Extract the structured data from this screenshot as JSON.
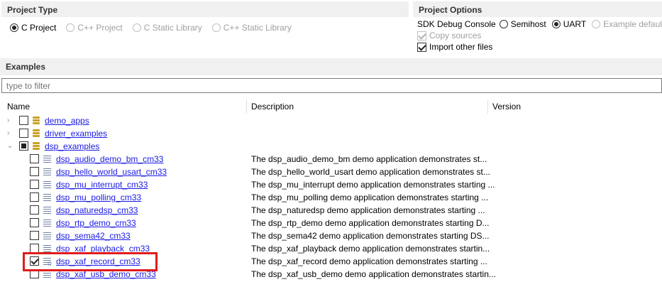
{
  "project_type": {
    "header": "Project Type",
    "options": [
      {
        "label": "C Project",
        "selected": true,
        "disabled": false
      },
      {
        "label": "C++ Project",
        "selected": false,
        "disabled": true
      },
      {
        "label": "C Static Library",
        "selected": false,
        "disabled": true
      },
      {
        "label": "C++ Static Library",
        "selected": false,
        "disabled": true
      }
    ]
  },
  "project_options": {
    "header": "Project Options",
    "console_label": "SDK Debug Console",
    "console_options": [
      {
        "label": "Semihost",
        "selected": false,
        "disabled": false
      },
      {
        "label": "UART",
        "selected": true,
        "disabled": false
      },
      {
        "label": "Example default",
        "selected": false,
        "disabled": true
      }
    ],
    "copy_sources": {
      "label": "Copy sources",
      "checked": true,
      "disabled": true
    },
    "import_other_files": {
      "label": "Import other files",
      "checked": true,
      "disabled": false
    }
  },
  "examples": {
    "header": "Examples",
    "filter_placeholder": "type to filter",
    "columns": {
      "name": "Name",
      "description": "Description",
      "version": "Version"
    },
    "groups": [
      {
        "name": "demo_apps",
        "expanded": false,
        "check": "none"
      },
      {
        "name": "driver_examples",
        "expanded": false,
        "check": "none"
      },
      {
        "name": "dsp_examples",
        "expanded": true,
        "check": "partial"
      }
    ],
    "items": [
      {
        "name": "dsp_audio_demo_bm_cm33",
        "description": "The dsp_audio_demo_bm demo application demonstrates st...",
        "checked": false
      },
      {
        "name": "dsp_hello_world_usart_cm33",
        "description": "The dsp_hello_world_usart demo application demonstrates st...",
        "checked": false
      },
      {
        "name": "dsp_mu_interrupt_cm33",
        "description": "The dsp_mu_interrupt demo application demonstrates starting ...",
        "checked": false
      },
      {
        "name": "dsp_mu_polling_cm33",
        "description": "The dsp_mu_polling demo application demonstrates starting ...",
        "checked": false
      },
      {
        "name": "dsp_naturedsp_cm33",
        "description": "The dsp_naturedsp demo application demonstrates starting ...",
        "checked": false
      },
      {
        "name": "dsp_rtp_demo_cm33",
        "description": "The dsp_rtp_demo demo application demonstrates starting D...",
        "checked": false
      },
      {
        "name": "dsp_sema42_cm33",
        "description": "The dsp_sema42 demo application demonstrates starting DS...",
        "checked": false
      },
      {
        "name": "dsp_xaf_playback_cm33",
        "description": "The dsp_xaf_playback demo application demonstrates startin...",
        "checked": false
      },
      {
        "name": "dsp_xaf_record_cm33",
        "description": "The dsp_xaf_record demo application demonstrates starting ...",
        "checked": true
      },
      {
        "name": "dsp_xaf_usb_demo_cm33",
        "description": "The dsp_xaf_usb_demo demo application demonstrates startin...",
        "checked": false
      }
    ]
  },
  "colors": {
    "highlight": "#e01c1c",
    "link": "#1a1ae6",
    "header_bg": "#f0f0f0"
  }
}
